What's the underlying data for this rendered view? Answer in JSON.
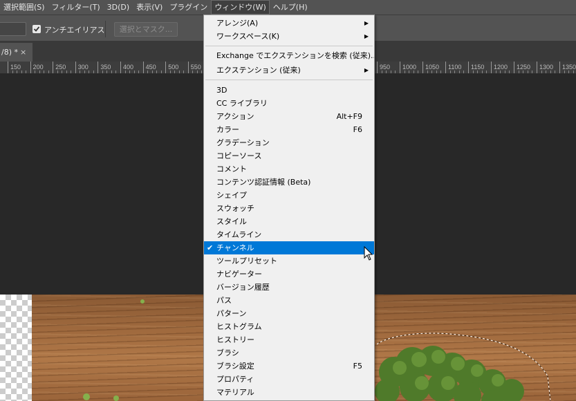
{
  "menubar": {
    "items": [
      "選択範囲(S)",
      "フィルター(T)",
      "3D(D)",
      "表示(V)",
      "プラグイン",
      "ウィンドウ(W)",
      "ヘルプ(H)"
    ]
  },
  "options": {
    "antialias_label": "アンチエイリアス",
    "antialias_checked": true,
    "select_mask_label": "選択とマスク..."
  },
  "tab": {
    "title": "/8) *",
    "close": "×"
  },
  "ruler": {
    "labels": [
      "150",
      "200",
      "250",
      "300",
      "350",
      "400",
      "450",
      "500",
      "550",
      "950",
      "1000",
      "1050",
      "1100",
      "1150",
      "1200",
      "1250",
      "1300",
      "1350"
    ]
  },
  "window_menu": {
    "items": [
      {
        "label": "アレンジ(A)",
        "submenu": true
      },
      {
        "label": "ワークスペース(K)",
        "submenu": true
      },
      {
        "label": "Exchange でエクステンションを検索 (従来)..."
      },
      {
        "label": "エクステンション (従来)",
        "submenu": true
      },
      {
        "label": "3D"
      },
      {
        "label": "CC ライブラリ"
      },
      {
        "label": "アクション",
        "shortcut": "Alt+F9"
      },
      {
        "label": "カラー",
        "shortcut": "F6"
      },
      {
        "label": "グラデーション"
      },
      {
        "label": "コピーソース"
      },
      {
        "label": "コメント"
      },
      {
        "label": "コンテンツ認証情報 (Beta)"
      },
      {
        "label": "シェイプ"
      },
      {
        "label": "スウォッチ"
      },
      {
        "label": "スタイル"
      },
      {
        "label": "タイムライン"
      },
      {
        "label": "チャンネル",
        "checked": true,
        "highlighted": true
      },
      {
        "label": "ツールプリセット"
      },
      {
        "label": "ナビゲーター"
      },
      {
        "label": "ヒストリー"
      },
      {
        "label": "ブラシ"
      },
      {
        "label": "ブラシ設定",
        "shortcut": "F5"
      },
      {
        "label": "プロパティ"
      },
      {
        "label": "マテリアル"
      }
    ],
    "hidden_items_note": ""
  },
  "colors": {
    "menu_highlight": "#0078d7",
    "menubar_bg": "#535353",
    "pasteboard_bg": "#282828"
  }
}
